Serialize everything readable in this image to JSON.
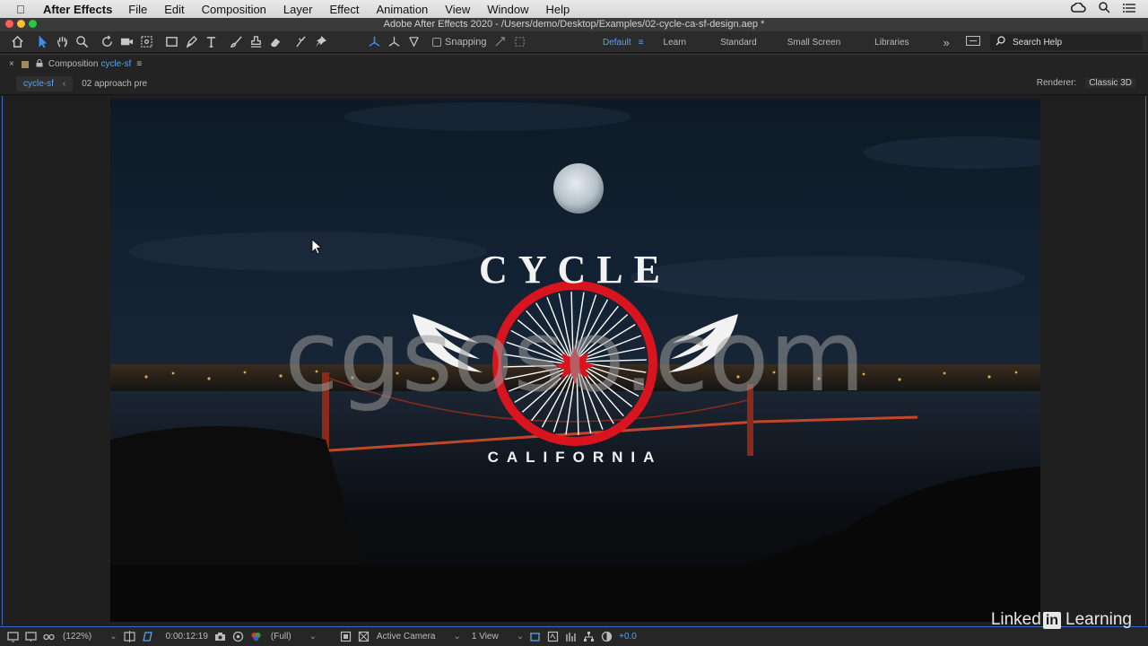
{
  "menubar": {
    "app_name": "After Effects",
    "items": [
      "File",
      "Edit",
      "Composition",
      "Layer",
      "Effect",
      "Animation",
      "View",
      "Window",
      "Help"
    ]
  },
  "window": {
    "title": "Adobe After Effects 2020 - /Users/demo/Desktop/Examples/02-cycle-ca-sf-design.aep *"
  },
  "toolbar": {
    "snapping_label": "Snapping",
    "workspaces": [
      "Default",
      "Learn",
      "Standard",
      "Small Screen",
      "Libraries"
    ],
    "active_workspace": "Default",
    "search_label": "Search Help"
  },
  "panel": {
    "prefix": "Composition",
    "comp_name": "cycle-sf",
    "breadcrumb_active": "cycle-sf",
    "breadcrumb_next": "02 approach pre",
    "renderer_label": "Renderer:",
    "renderer_value": "Classic 3D"
  },
  "composition": {
    "logo_top": "CYCLE",
    "logo_bottom": "CALIFORNIA",
    "overlay_text": "cgsoso.com",
    "accent_color": "#d8141f"
  },
  "viewer_footer": {
    "zoom": "(122%)",
    "timecode": "0:00:12:19",
    "resolution": "(Full)",
    "camera": "Active Camera",
    "view_layout": "1 View",
    "exposure": "+0.0"
  },
  "watermark": {
    "part1": "Linked",
    "part2": "in",
    "part3": "Learning"
  }
}
